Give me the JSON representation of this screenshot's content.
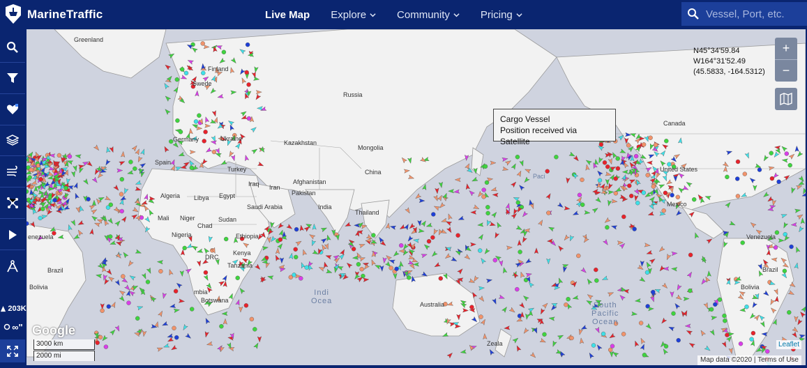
{
  "brand": {
    "name": "MarineTraffic"
  },
  "nav": {
    "items": [
      {
        "label": "Live Map",
        "active": true
      },
      {
        "label": "Explore",
        "active": false
      },
      {
        "label": "Community",
        "active": false
      },
      {
        "label": "Pricing",
        "active": false
      }
    ]
  },
  "search": {
    "placeholder": "Vessel, Port, etc."
  },
  "sidebar": {
    "buttons": [
      "search-icon",
      "filter-icon",
      "heart-icon",
      "layers-icon",
      "wind-icon",
      "network-icon",
      "play-icon",
      "compass-icon",
      "expand-icon"
    ],
    "vessel_count": "203K",
    "infinity_label": "∞\""
  },
  "map": {
    "coords": {
      "lat": "N45°34'59.84",
      "lon": "W164°31'52.49",
      "decimal": "(45.5833, -164.5312)"
    },
    "zoom_in": "+",
    "zoom_out": "−",
    "tooltip": {
      "line1": "Cargo Vessel",
      "line2": "Position received via Satellite"
    },
    "labels": {
      "greenland": "Greenland",
      "finland": "Finland",
      "sweden": "Swede",
      "russia": "Russia",
      "canada": "Canada",
      "germany": "Germany",
      "ukraine": "Ukraine",
      "kazakhstan": "Kazakhstan",
      "mongolia": "Mongolia",
      "china": "China",
      "spain": "Spain",
      "turkey": "Turkey",
      "iraq": "Iraq",
      "iran": "Iran",
      "afghanistan": "Afghanistan",
      "pakistan": "Pakistan",
      "egypt": "Egypt",
      "algeria": "Algeria",
      "libya": "Libya",
      "saudi": "Saudi Arabia",
      "india": "India",
      "thailand": "Thailand",
      "mali": "Mali",
      "niger": "Niger",
      "chad": "Chad",
      "sudan": "Sudan",
      "nigeria": "Nigeria",
      "ethiopia": "Ethiopia",
      "kenya": "Kenya",
      "drc": "DRC",
      "tanzania": "Tanzania",
      "zambia": "mbia",
      "botswana": "Botswana",
      "brazil": "Brazil",
      "bolivia": "Bolivia",
      "venezuela": "enezuela",
      "venezuela2": "Venezuela",
      "brazil2": "Brazil",
      "bolivia2": "Bolivia",
      "australia": "Australia",
      "usa": "United States",
      "mexico": "Mexico",
      "zealand": "Zeala",
      "pacific_label": "Paci"
    },
    "ocean": {
      "south_pacific": "South\nPacific\nOcean",
      "indian": "Indi\nOcea"
    },
    "google": "Google",
    "scale_km": "3000 km",
    "scale_mi": "2000 mi",
    "leaflet": "Leaflet",
    "attrib_data": "Map data ©2020",
    "attrib_terms": "Terms of Use"
  },
  "colors": {
    "topbar": "#0a2570",
    "cargo": "#3fd43f",
    "tanker": "#e8222b",
    "passenger": "#1e3fd8",
    "fishing": "#f1936b",
    "pleasure": "#d93ee8",
    "tug": "#3ee0e8",
    "unknown": "#c9c9c9"
  }
}
